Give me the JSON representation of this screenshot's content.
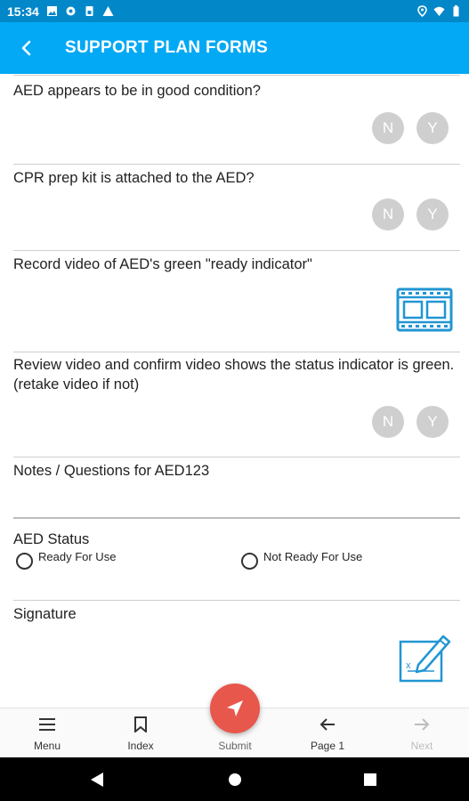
{
  "status_bar": {
    "time": "15:34",
    "left_icons": [
      "image-icon",
      "gear-icon",
      "sim-icon",
      "warning-icon"
    ],
    "right_icons": [
      "location-icon",
      "wifi-icon",
      "battery-icon"
    ]
  },
  "app_bar": {
    "title": "SUPPORT PLAN FORMS"
  },
  "questions": [
    {
      "text": "AED appears to be in good condition?",
      "no": "N",
      "yes": "Y"
    },
    {
      "text": "CPR prep kit is attached to the AED?",
      "no": "N",
      "yes": "Y"
    },
    {
      "text": "Record video of AED's green \"ready indicator\""
    },
    {
      "text": "Review video and confirm video shows the status indicator is green.  (retake video if not)",
      "no": "N",
      "yes": "Y"
    },
    {
      "text": "Notes / Questions for AED123"
    }
  ],
  "aed_status": {
    "label": "AED Status",
    "options": [
      "Ready For Use",
      "Not Ready For Use"
    ]
  },
  "signature": {
    "label": "Signature"
  },
  "bottom_nav": {
    "menu": "Menu",
    "index": "Index",
    "submit": "Submit",
    "page": "Page 1",
    "next": "Next"
  },
  "colors": {
    "accent": "#03a9f4",
    "status_bar": "#0288c9",
    "fab": "#e8574b",
    "icon_blue": "#2196d3"
  }
}
